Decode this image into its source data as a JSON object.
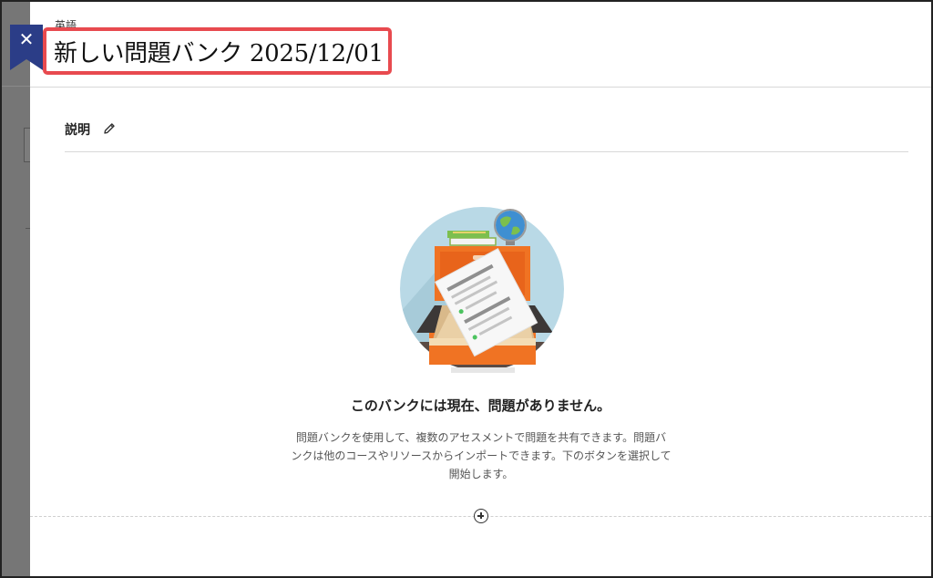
{
  "header": {
    "course_name": "英語",
    "title": "新しい問題バンク 2025/12/01",
    "close_label": "✕"
  },
  "description": {
    "label": "説明"
  },
  "empty_state": {
    "title": "このバンクには現在、問題がありません。",
    "text": "問題バンクを使用して、複数のアセスメントで問題を共有できます。問題バンクは他のコースやリソースからインポートできます。下のボタンを選択して開始します。"
  },
  "icons": {
    "close": "close-icon",
    "edit": "pencil-icon",
    "add": "plus-circle-icon"
  },
  "colors": {
    "accent_close": "#2b3d87",
    "highlight": "#e84a4f"
  }
}
